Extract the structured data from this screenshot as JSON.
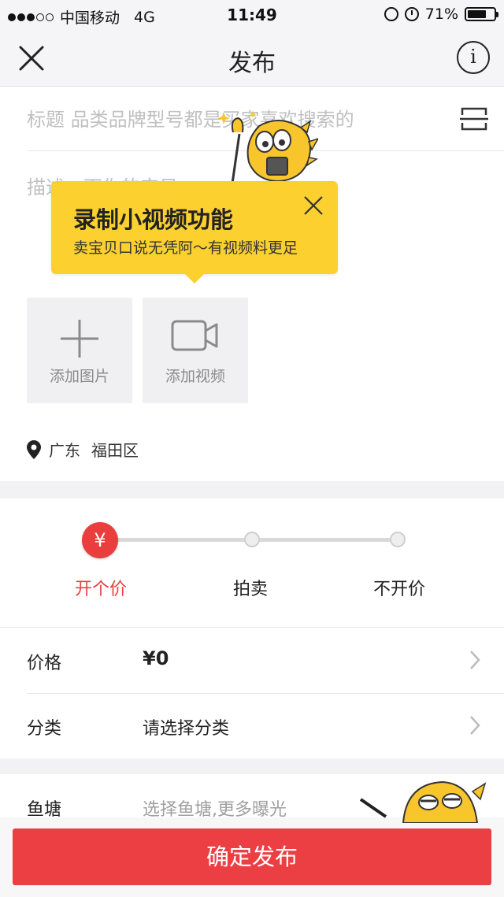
{
  "status_bar": {
    "carrier": "中国移动",
    "network": "4G",
    "time": "11:49",
    "battery_text": "71%",
    "battery_level": 0.71
  },
  "nav": {
    "title": "发布",
    "close_icon": "close-icon",
    "info_icon": "info-icon",
    "info_glyph": "i"
  },
  "form": {
    "title_placeholder": "标题 品类品牌型号都是买家喜欢搜索的",
    "description_placeholder": "描述一下你的宝贝"
  },
  "tooltip": {
    "title": "录制小视频功能",
    "subtitle": "卖宝贝口说无凭阿～有视频料更足"
  },
  "media": {
    "add_image_label": "添加图片",
    "add_video_label": "添加视频"
  },
  "location": {
    "province": "广东",
    "district": "福田区"
  },
  "price_mode": {
    "currency_symbol": "¥",
    "options": [
      "开个价",
      "拍卖",
      "不开价"
    ],
    "selected_index": 0,
    "active_color": "#e94040"
  },
  "rows": {
    "price_label": "价格",
    "price_value": "¥0",
    "category_label": "分类",
    "category_value": "请选择分类",
    "pond_label": "鱼塘",
    "pond_value": "选择鱼塘,更多曝光"
  },
  "submit_label": "确定发布",
  "colors": {
    "accent_red": "#ec3f43",
    "tooltip_yellow": "#fbd02f"
  }
}
